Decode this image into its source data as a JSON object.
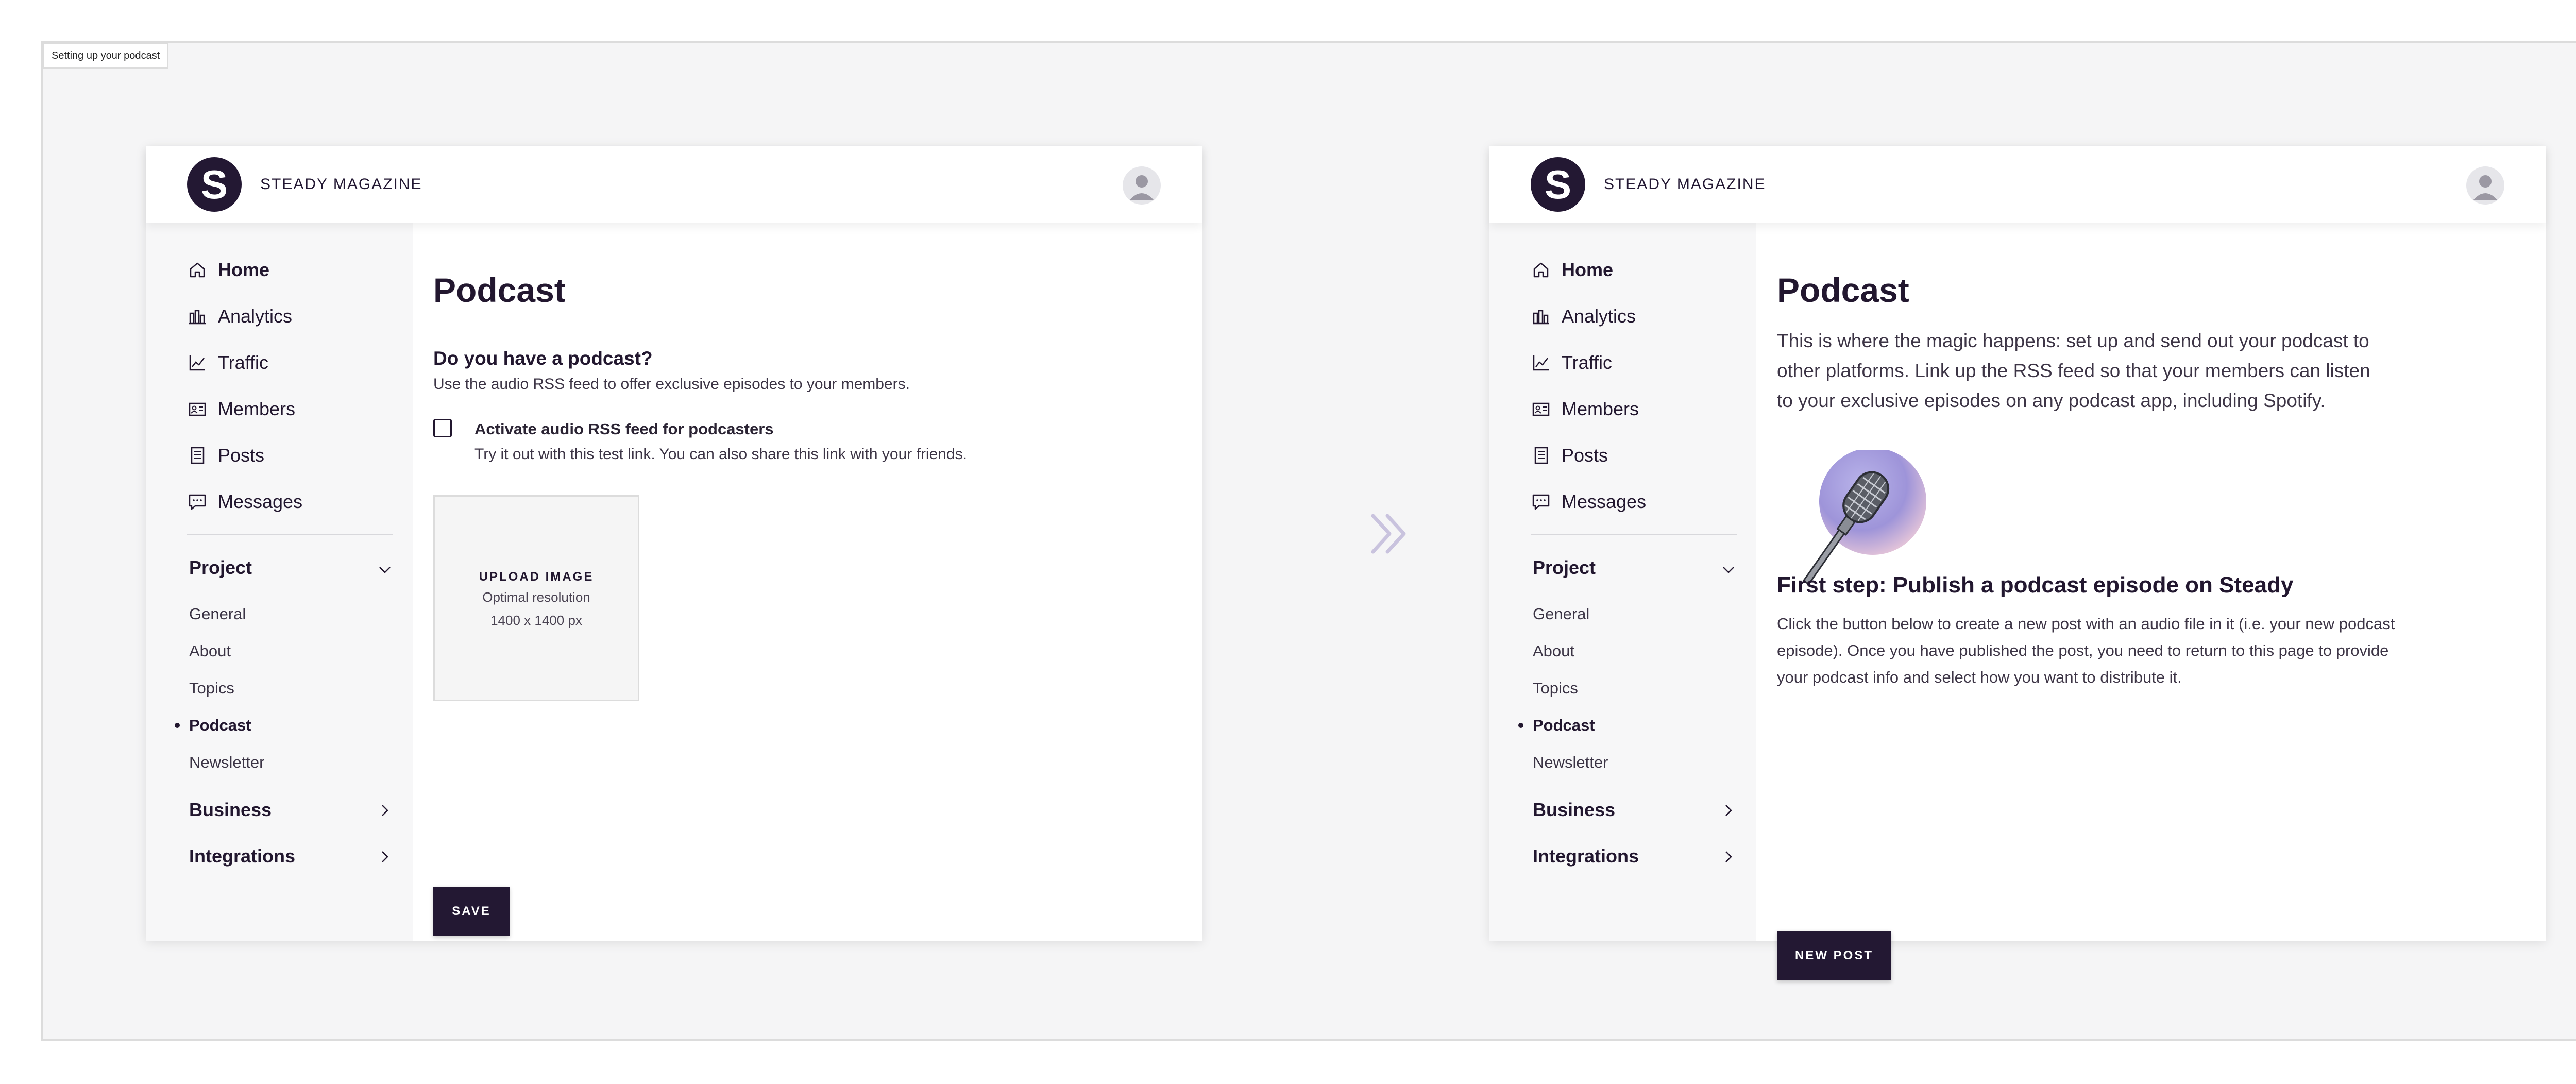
{
  "frame_label": "Setting up your podcast",
  "brand": "STEADY MAGAZINE",
  "logo_letter": "S",
  "nav": {
    "items": [
      {
        "label": "Home",
        "icon": "home-icon"
      },
      {
        "label": "Analytics",
        "icon": "bar-chart-icon"
      },
      {
        "label": "Traffic",
        "icon": "line-chart-icon"
      },
      {
        "label": "Members",
        "icon": "id-card-icon"
      },
      {
        "label": "Posts",
        "icon": "document-icon"
      },
      {
        "label": "Messages",
        "icon": "message-icon"
      }
    ],
    "project": {
      "label": "Project",
      "subitems": [
        "General",
        "About",
        "Topics",
        "Podcast",
        "Newsletter"
      ],
      "active": "Podcast"
    },
    "business": {
      "label": "Business"
    },
    "integrations": {
      "label": "Integrations"
    }
  },
  "left": {
    "title": "Podcast",
    "question": "Do you have a podcast?",
    "question_sub": "Use the audio RSS feed to offer exclusive episodes to your members.",
    "checkbox_label": "Activate audio RSS feed for podcasters",
    "checkbox_sub": "Try it out with this test link. You can also share this link with your friends.",
    "upload_title": "UPLOAD IMAGE",
    "upload_sub1": "Optimal resolution",
    "upload_sub2": "1400 x 1400 px",
    "save_label": "SAVE"
  },
  "right": {
    "title": "Podcast",
    "intro": "This is where the magic happens: set up and send out your podcast to other platforms. Link up the RSS feed so that your members can listen to your exclusive episodes on any podcast app, including Spotify.",
    "step_title": "First step: Publish a podcast episode on Steady",
    "step_body": "Click the button below to create a new post with an audio file in it (i.e. your new podcast episode). Once you have published the post, you need to return to this page to provide your podcast info and select how you want to distribute it.",
    "new_post_label": "NEW POST"
  },
  "colors": {
    "brand_dark": "#231833",
    "sidebar_bg": "#f7f7f8",
    "canvas_bg": "#f5f5f6",
    "arrow": "#c9c3de"
  }
}
